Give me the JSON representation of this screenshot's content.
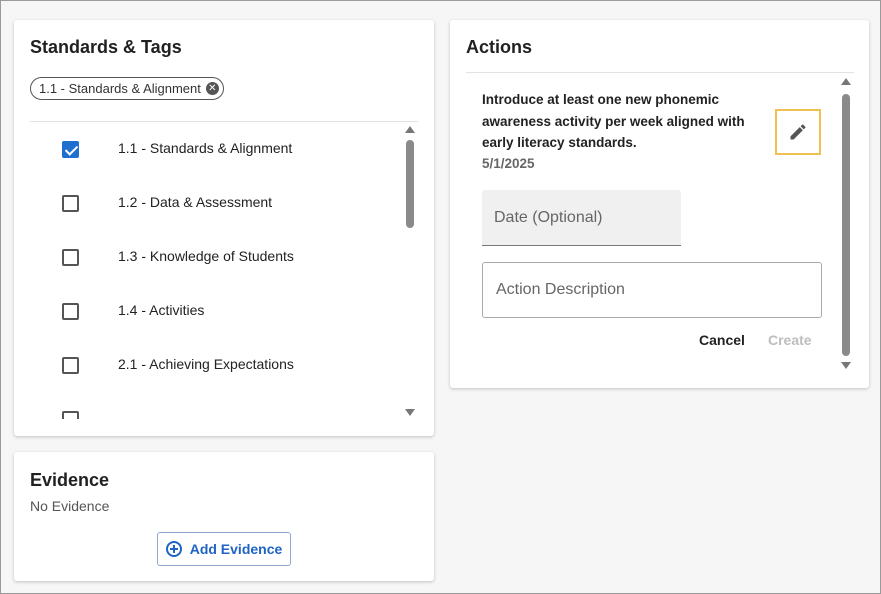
{
  "standards": {
    "title": "Standards & Tags",
    "selected_chips": [
      "1.1 - Standards & Alignment"
    ],
    "items": [
      {
        "label": "1.1 - Standards & Alignment",
        "checked": true
      },
      {
        "label": "1.2 - Data & Assessment",
        "checked": false
      },
      {
        "label": "1.3 - Knowledge of Students",
        "checked": false
      },
      {
        "label": "1.4 - Activities",
        "checked": false
      },
      {
        "label": "2.1 - Achieving Expectations",
        "checked": false
      },
      {
        "label": "",
        "checked": false
      }
    ]
  },
  "evidence": {
    "title": "Evidence",
    "empty_text": "No Evidence",
    "add_label": "Add Evidence"
  },
  "actions": {
    "title": "Actions",
    "item": {
      "text": "Introduce at least one new phonemic awareness activity per week aligned with early literacy standards.",
      "date": "5/1/2025"
    },
    "date_placeholder": "Date (Optional)",
    "description_placeholder": "Action Description",
    "cancel_label": "Cancel",
    "create_label": "Create"
  },
  "colors": {
    "accent": "#1f6fd1",
    "edit_highlight": "#f0c050"
  }
}
